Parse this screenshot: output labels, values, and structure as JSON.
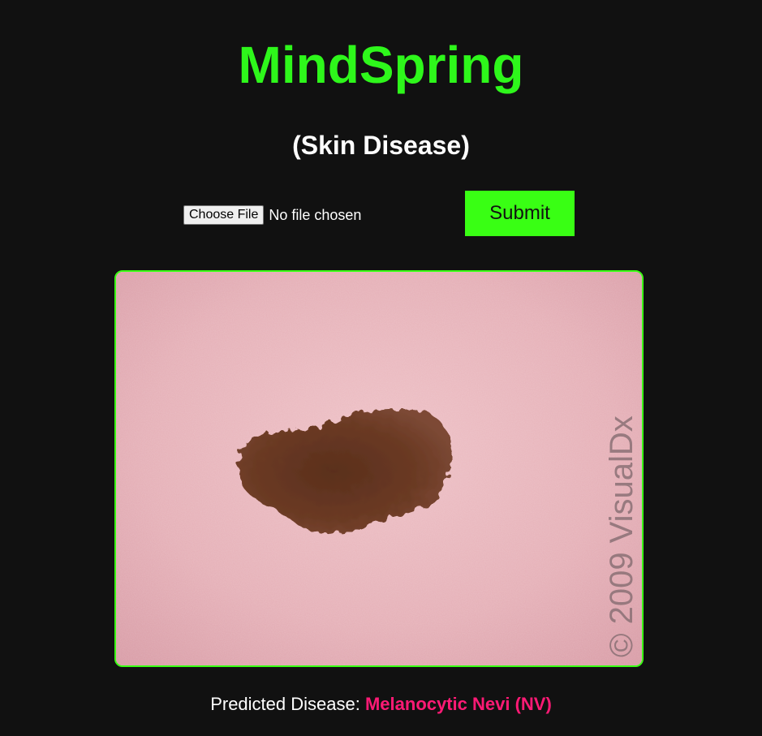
{
  "header": {
    "title": "MindSpring",
    "subtitle": "(Skin Disease)"
  },
  "upload": {
    "choose_file_label": "Choose File",
    "file_status": "No file chosen",
    "submit_label": "Submit"
  },
  "image": {
    "watermark": "© 2009 VisualDx"
  },
  "result": {
    "label": "Predicted Disease:",
    "value": "Melanocytic Nevi (NV)"
  },
  "colors": {
    "background": "#111111",
    "title": "#2ef71b",
    "accent": "#39ff14",
    "prediction": "#ff1a75"
  }
}
